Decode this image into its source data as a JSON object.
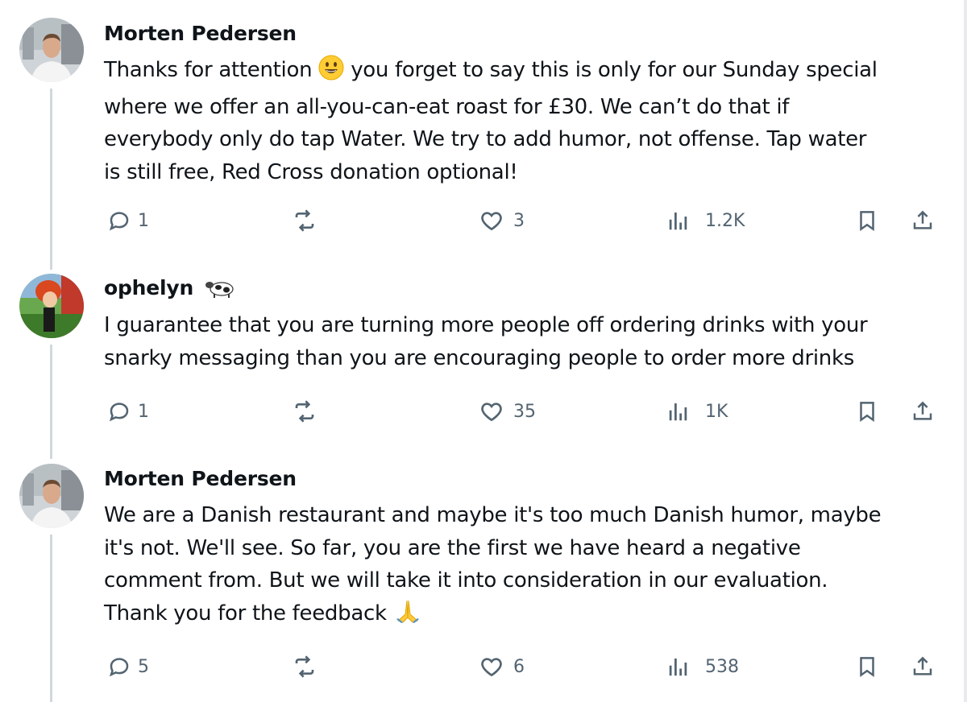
{
  "tweets": [
    {
      "author": "Morten Pedersen",
      "lines": [
        "Thanks for attention",
        "you forget to say this is only for our Sunday special",
        "where we offer an all-you-can-eat roast for £30. We can’t do that if",
        "everybody only do tap Water. We try to add humor, not offense. Tap water",
        "is still free, Red Cross donation optional!"
      ],
      "emoji": "grinning-face",
      "replies": "1",
      "retweets": "",
      "likes": "3",
      "views": "1.2K"
    },
    {
      "author": "ophelyn",
      "name_emoji": "cow-icon",
      "lines": [
        "I guarantee that you are turning more people off ordering drinks with your",
        "snarky messaging than you are encouraging people to order more drinks"
      ],
      "replies": "1",
      "retweets": "",
      "likes": "35",
      "views": "1K"
    },
    {
      "author": "Morten Pedersen",
      "lines": [
        "We are a Danish restaurant and maybe it's too much Danish humor, maybe",
        "it's not. We'll see. So far, you are the first we have heard a negative",
        "comment from. But we will take it into consideration in our evaluation.",
        "Thank you for the feedback"
      ],
      "emoji": "folded-hands",
      "replies": "5",
      "retweets": "",
      "likes": "6",
      "views": "538"
    }
  ],
  "colors": {
    "text": "#0f1419",
    "muted": "#536471",
    "thread_line": "#cfd9de"
  }
}
